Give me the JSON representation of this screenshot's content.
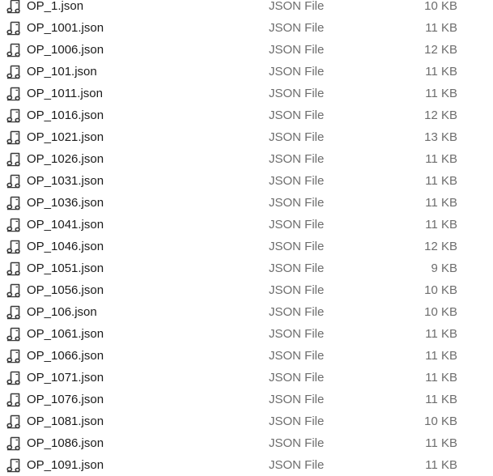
{
  "files": [
    {
      "name": "OP_1.json",
      "type": "JSON File",
      "size": "10 KB",
      "icon": "json-file-icon"
    },
    {
      "name": "OP_1001.json",
      "type": "JSON File",
      "size": "11 KB",
      "icon": "json-file-icon"
    },
    {
      "name": "OP_1006.json",
      "type": "JSON File",
      "size": "12 KB",
      "icon": "json-file-icon"
    },
    {
      "name": "OP_101.json",
      "type": "JSON File",
      "size": "11 KB",
      "icon": "json-file-icon"
    },
    {
      "name": "OP_1011.json",
      "type": "JSON File",
      "size": "11 KB",
      "icon": "json-file-icon"
    },
    {
      "name": "OP_1016.json",
      "type": "JSON File",
      "size": "12 KB",
      "icon": "json-file-icon"
    },
    {
      "name": "OP_1021.json",
      "type": "JSON File",
      "size": "13 KB",
      "icon": "json-file-icon"
    },
    {
      "name": "OP_1026.json",
      "type": "JSON File",
      "size": "11 KB",
      "icon": "json-file-icon"
    },
    {
      "name": "OP_1031.json",
      "type": "JSON File",
      "size": "11 KB",
      "icon": "json-file-icon"
    },
    {
      "name": "OP_1036.json",
      "type": "JSON File",
      "size": "11 KB",
      "icon": "json-file-icon"
    },
    {
      "name": "OP_1041.json",
      "type": "JSON File",
      "size": "11 KB",
      "icon": "json-file-icon"
    },
    {
      "name": "OP_1046.json",
      "type": "JSON File",
      "size": "12 KB",
      "icon": "json-file-icon"
    },
    {
      "name": "OP_1051.json",
      "type": "JSON File",
      "size": "9 KB",
      "icon": "json-file-icon"
    },
    {
      "name": "OP_1056.json",
      "type": "JSON File",
      "size": "10 KB",
      "icon": "json-file-icon"
    },
    {
      "name": "OP_106.json",
      "type": "JSON File",
      "size": "10 KB",
      "icon": "json-file-icon"
    },
    {
      "name": "OP_1061.json",
      "type": "JSON File",
      "size": "11 KB",
      "icon": "json-file-icon"
    },
    {
      "name": "OP_1066.json",
      "type": "JSON File",
      "size": "11 KB",
      "icon": "json-file-icon"
    },
    {
      "name": "OP_1071.json",
      "type": "JSON File",
      "size": "11 KB",
      "icon": "json-file-icon"
    },
    {
      "name": "OP_1076.json",
      "type": "JSON File",
      "size": "11 KB",
      "icon": "json-file-icon"
    },
    {
      "name": "OP_1081.json",
      "type": "JSON File",
      "size": "10 KB",
      "icon": "json-file-icon"
    },
    {
      "name": "OP_1086.json",
      "type": "JSON File",
      "size": "11 KB",
      "icon": "json-file-icon"
    },
    {
      "name": "OP_1091.json",
      "type": "JSON File",
      "size": "11 KB",
      "icon": "json-file-icon"
    }
  ]
}
